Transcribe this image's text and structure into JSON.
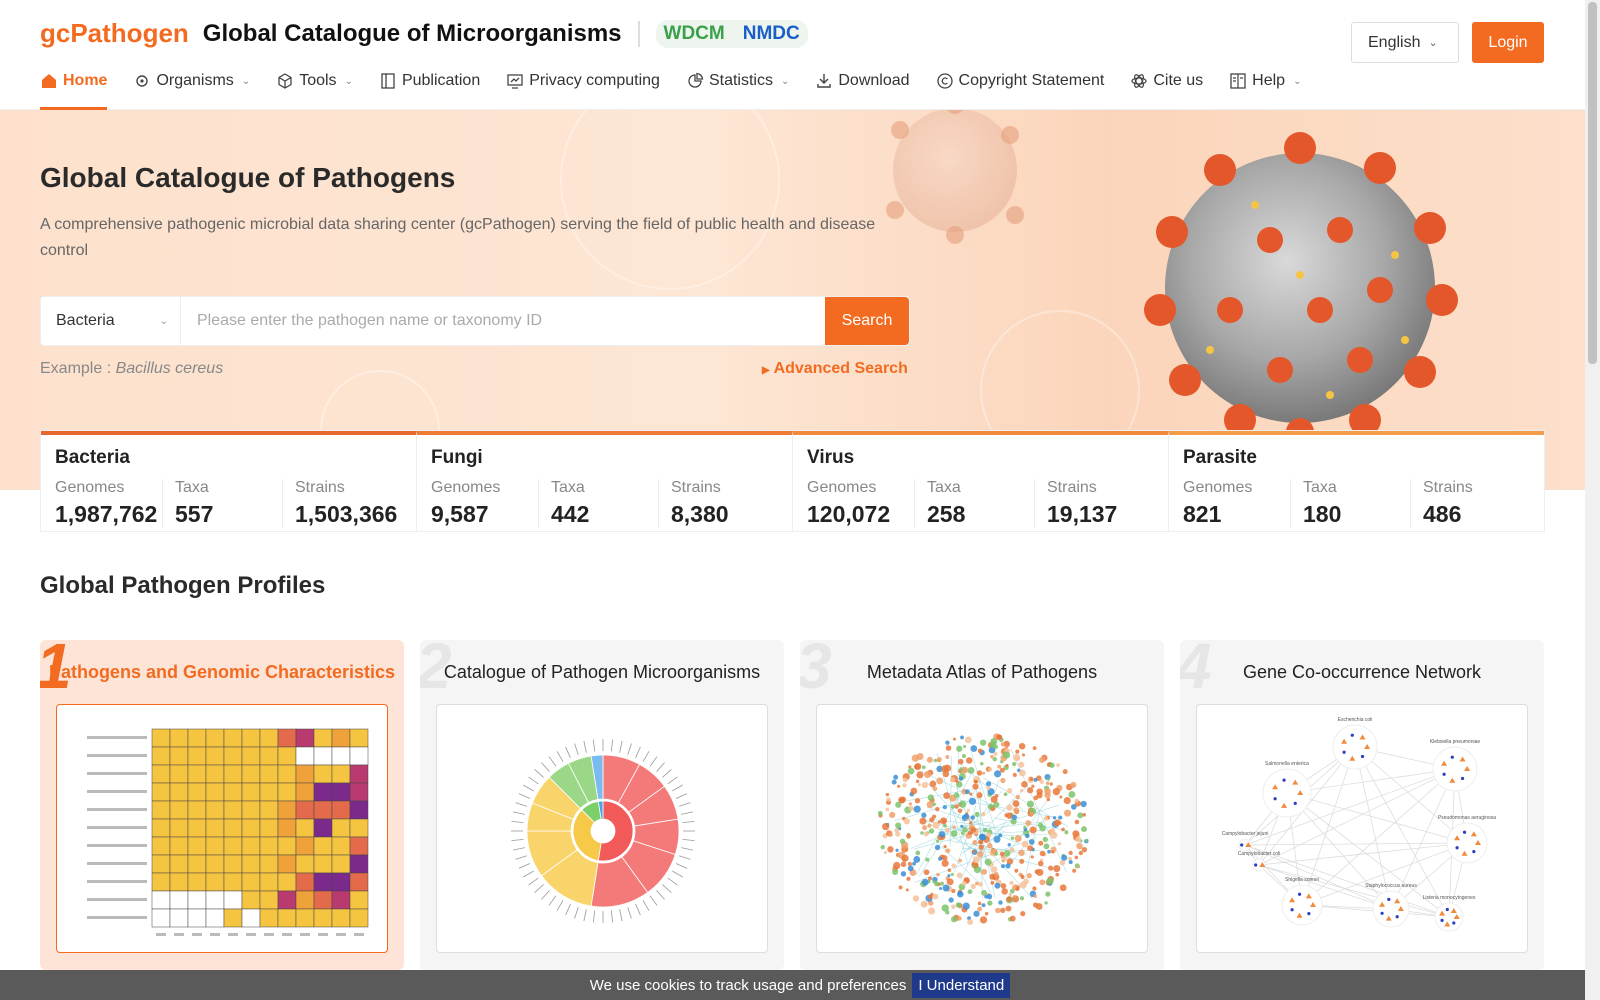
{
  "header": {
    "logo": "gcPathogen",
    "title": "Global Catalogue of Microorganisms",
    "partners": [
      "WDCM",
      "NMDC"
    ],
    "language": "English",
    "login_label": "Login"
  },
  "nav": [
    {
      "label": "Home",
      "icon": "home-icon",
      "active": true,
      "dropdown": false
    },
    {
      "label": "Organisms",
      "icon": "organism-icon",
      "active": false,
      "dropdown": true
    },
    {
      "label": "Tools",
      "icon": "cube-icon",
      "active": false,
      "dropdown": true
    },
    {
      "label": "Publication",
      "icon": "book-icon",
      "active": false,
      "dropdown": false
    },
    {
      "label": "Privacy computing",
      "icon": "monitor-icon",
      "active": false,
      "dropdown": false
    },
    {
      "label": "Statistics",
      "icon": "pie-chart-icon",
      "active": false,
      "dropdown": true
    },
    {
      "label": "Download",
      "icon": "download-icon",
      "active": false,
      "dropdown": false
    },
    {
      "label": "Copyright Statement",
      "icon": "copyright-icon",
      "active": false,
      "dropdown": false
    },
    {
      "label": "Cite us",
      "icon": "atom-icon",
      "active": false,
      "dropdown": false
    },
    {
      "label": "Help",
      "icon": "help-book-icon",
      "active": false,
      "dropdown": true
    }
  ],
  "hero": {
    "title": "Global Catalogue of Pathogens",
    "subtitle": "A comprehensive pathogenic microbial data sharing center (gcPathogen) serving the field of public health and disease control",
    "search_type": "Bacteria",
    "search_placeholder": "Please enter the pathogen name or taxonomy ID",
    "search_button": "Search",
    "example_label": "Example :",
    "example_value": "Bacillus cereus",
    "advanced_search": "Advanced Search"
  },
  "stats": [
    {
      "name": "Bacteria",
      "genomes_label": "Genomes",
      "taxa_label": "Taxa",
      "strains_label": "Strains",
      "genomes": "1,987,762",
      "taxa": "557",
      "strains": "1,503,366"
    },
    {
      "name": "Fungi",
      "genomes_label": "Genomes",
      "taxa_label": "Taxa",
      "strains_label": "Strains",
      "genomes": "9,587",
      "taxa": "442",
      "strains": "8,380"
    },
    {
      "name": "Virus",
      "genomes_label": "Genomes",
      "taxa_label": "Taxa",
      "strains_label": "Strains",
      "genomes": "120,072",
      "taxa": "258",
      "strains": "19,137"
    },
    {
      "name": "Parasite",
      "genomes_label": "Genomes",
      "taxa_label": "Taxa",
      "strains_label": "Strains",
      "genomes": "821",
      "taxa": "180",
      "strains": "486"
    }
  ],
  "profiles": {
    "section_title": "Global Pathogen Profiles",
    "cards": [
      {
        "num": "1",
        "title": "Pathogens and Genomic Characteristics",
        "active": true
      },
      {
        "num": "2",
        "title": "Catalogue of Pathogen Microorganisms",
        "active": false
      },
      {
        "num": "3",
        "title": "Metadata Atlas of Pathogens",
        "active": false
      },
      {
        "num": "4",
        "title": "Gene Co-occurrence Network",
        "active": false
      }
    ],
    "network_nodes": [
      "Escherichia coli",
      "Klebsiella pneumoniae",
      "Salmonella enterica",
      "Pseudomonas aeruginosa",
      "Campylobacter jejuni",
      "Campylobacter coli",
      "Shigella sonnei",
      "Staphylococcus aureus",
      "Listeria monocytogenes"
    ]
  },
  "cookie": {
    "text": "We use cookies to track usage and preferences",
    "button": "I Understand"
  },
  "colors": {
    "accent": "#f26b21",
    "wdcm": "#3aa14b",
    "nmdc": "#1a5ec9",
    "cookie_button": "#1f3a8a"
  }
}
